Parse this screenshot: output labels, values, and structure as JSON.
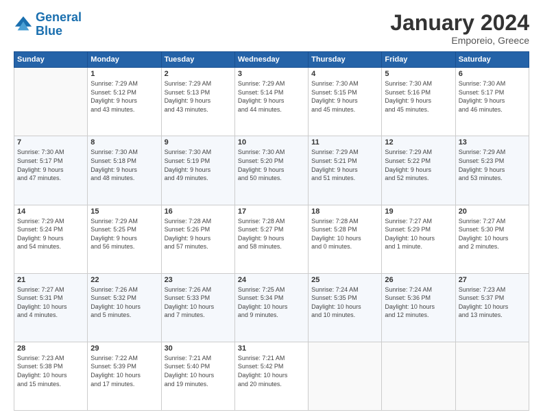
{
  "logo": {
    "line1": "General",
    "line2": "Blue"
  },
  "title": "January 2024",
  "location": "Emporeio, Greece",
  "days_header": [
    "Sunday",
    "Monday",
    "Tuesday",
    "Wednesday",
    "Thursday",
    "Friday",
    "Saturday"
  ],
  "weeks": [
    [
      {
        "num": "",
        "info": ""
      },
      {
        "num": "1",
        "info": "Sunrise: 7:29 AM\nSunset: 5:12 PM\nDaylight: 9 hours\nand 43 minutes."
      },
      {
        "num": "2",
        "info": "Sunrise: 7:29 AM\nSunset: 5:13 PM\nDaylight: 9 hours\nand 43 minutes."
      },
      {
        "num": "3",
        "info": "Sunrise: 7:29 AM\nSunset: 5:14 PM\nDaylight: 9 hours\nand 44 minutes."
      },
      {
        "num": "4",
        "info": "Sunrise: 7:30 AM\nSunset: 5:15 PM\nDaylight: 9 hours\nand 45 minutes."
      },
      {
        "num": "5",
        "info": "Sunrise: 7:30 AM\nSunset: 5:16 PM\nDaylight: 9 hours\nand 45 minutes."
      },
      {
        "num": "6",
        "info": "Sunrise: 7:30 AM\nSunset: 5:17 PM\nDaylight: 9 hours\nand 46 minutes."
      }
    ],
    [
      {
        "num": "7",
        "info": "Sunrise: 7:30 AM\nSunset: 5:17 PM\nDaylight: 9 hours\nand 47 minutes."
      },
      {
        "num": "8",
        "info": "Sunrise: 7:30 AM\nSunset: 5:18 PM\nDaylight: 9 hours\nand 48 minutes."
      },
      {
        "num": "9",
        "info": "Sunrise: 7:30 AM\nSunset: 5:19 PM\nDaylight: 9 hours\nand 49 minutes."
      },
      {
        "num": "10",
        "info": "Sunrise: 7:30 AM\nSunset: 5:20 PM\nDaylight: 9 hours\nand 50 minutes."
      },
      {
        "num": "11",
        "info": "Sunrise: 7:29 AM\nSunset: 5:21 PM\nDaylight: 9 hours\nand 51 minutes."
      },
      {
        "num": "12",
        "info": "Sunrise: 7:29 AM\nSunset: 5:22 PM\nDaylight: 9 hours\nand 52 minutes."
      },
      {
        "num": "13",
        "info": "Sunrise: 7:29 AM\nSunset: 5:23 PM\nDaylight: 9 hours\nand 53 minutes."
      }
    ],
    [
      {
        "num": "14",
        "info": "Sunrise: 7:29 AM\nSunset: 5:24 PM\nDaylight: 9 hours\nand 54 minutes."
      },
      {
        "num": "15",
        "info": "Sunrise: 7:29 AM\nSunset: 5:25 PM\nDaylight: 9 hours\nand 56 minutes."
      },
      {
        "num": "16",
        "info": "Sunrise: 7:28 AM\nSunset: 5:26 PM\nDaylight: 9 hours\nand 57 minutes."
      },
      {
        "num": "17",
        "info": "Sunrise: 7:28 AM\nSunset: 5:27 PM\nDaylight: 9 hours\nand 58 minutes."
      },
      {
        "num": "18",
        "info": "Sunrise: 7:28 AM\nSunset: 5:28 PM\nDaylight: 10 hours\nand 0 minutes."
      },
      {
        "num": "19",
        "info": "Sunrise: 7:27 AM\nSunset: 5:29 PM\nDaylight: 10 hours\nand 1 minute."
      },
      {
        "num": "20",
        "info": "Sunrise: 7:27 AM\nSunset: 5:30 PM\nDaylight: 10 hours\nand 2 minutes."
      }
    ],
    [
      {
        "num": "21",
        "info": "Sunrise: 7:27 AM\nSunset: 5:31 PM\nDaylight: 10 hours\nand 4 minutes."
      },
      {
        "num": "22",
        "info": "Sunrise: 7:26 AM\nSunset: 5:32 PM\nDaylight: 10 hours\nand 5 minutes."
      },
      {
        "num": "23",
        "info": "Sunrise: 7:26 AM\nSunset: 5:33 PM\nDaylight: 10 hours\nand 7 minutes."
      },
      {
        "num": "24",
        "info": "Sunrise: 7:25 AM\nSunset: 5:34 PM\nDaylight: 10 hours\nand 9 minutes."
      },
      {
        "num": "25",
        "info": "Sunrise: 7:24 AM\nSunset: 5:35 PM\nDaylight: 10 hours\nand 10 minutes."
      },
      {
        "num": "26",
        "info": "Sunrise: 7:24 AM\nSunset: 5:36 PM\nDaylight: 10 hours\nand 12 minutes."
      },
      {
        "num": "27",
        "info": "Sunrise: 7:23 AM\nSunset: 5:37 PM\nDaylight: 10 hours\nand 13 minutes."
      }
    ],
    [
      {
        "num": "28",
        "info": "Sunrise: 7:23 AM\nSunset: 5:38 PM\nDaylight: 10 hours\nand 15 minutes."
      },
      {
        "num": "29",
        "info": "Sunrise: 7:22 AM\nSunset: 5:39 PM\nDaylight: 10 hours\nand 17 minutes."
      },
      {
        "num": "30",
        "info": "Sunrise: 7:21 AM\nSunset: 5:40 PM\nDaylight: 10 hours\nand 19 minutes."
      },
      {
        "num": "31",
        "info": "Sunrise: 7:21 AM\nSunset: 5:42 PM\nDaylight: 10 hours\nand 20 minutes."
      },
      {
        "num": "",
        "info": ""
      },
      {
        "num": "",
        "info": ""
      },
      {
        "num": "",
        "info": ""
      }
    ]
  ]
}
